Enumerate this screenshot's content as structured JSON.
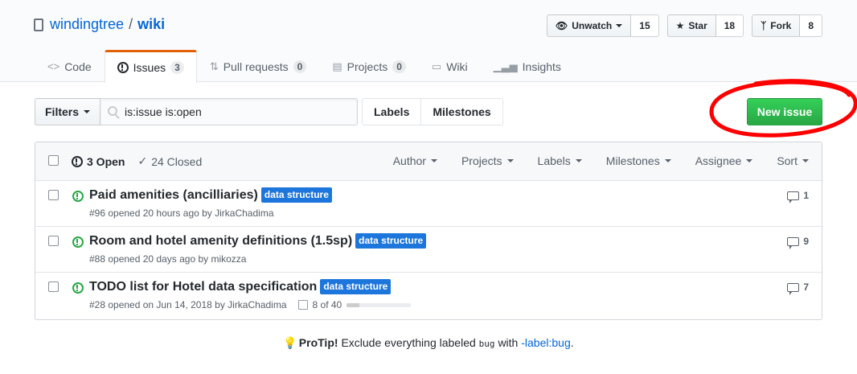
{
  "repo": {
    "owner": "windingtree",
    "separator": "/",
    "name": "wiki"
  },
  "actions": {
    "watch": {
      "label": "Unwatch",
      "count": "15"
    },
    "star": {
      "label": "Star",
      "count": "18"
    },
    "fork": {
      "label": "Fork",
      "count": "8"
    }
  },
  "nav": {
    "code": "Code",
    "issues": "Issues",
    "issues_count": "3",
    "pulls": "Pull requests",
    "pulls_count": "0",
    "projects": "Projects",
    "projects_count": "0",
    "wiki": "Wiki",
    "insights": "Insights"
  },
  "subnav": {
    "filters_label": "Filters",
    "search_value": "is:issue is:open",
    "labels": "Labels",
    "milestones": "Milestones",
    "new_issue": "New issue"
  },
  "list_header": {
    "open": "3 Open",
    "closed": "24 Closed",
    "menus": [
      "Author",
      "Projects",
      "Labels",
      "Milestones",
      "Assignee",
      "Sort"
    ]
  },
  "issues": [
    {
      "title": "Paid amenities (ancilliaries)",
      "label": "data structure",
      "meta": "#96 opened 20 hours ago by JirkaChadima",
      "comments": "1"
    },
    {
      "title": "Room and hotel amenity definitions (1.5sp)",
      "label": "data structure",
      "meta": "#88 opened 20 days ago by mikozza",
      "comments": "9"
    },
    {
      "title": "TODO list for Hotel data specification",
      "label": "data structure",
      "meta": "#28 opened on Jun 14, 2018 by JirkaChadima",
      "tasks": "8 of 40",
      "tasks_progress": 0.2,
      "comments": "7"
    }
  ],
  "protip": {
    "bold": "ProTip!",
    "text1": "Exclude everything labeled",
    "code": "bug",
    "text2": "with",
    "link": "-label:bug",
    "text3": "."
  },
  "colors": {
    "accent": "#0366d6",
    "new_issue": "#28a745",
    "label": "#1d76db",
    "nav_selected": "#e36209",
    "annotation": "#ff0000"
  }
}
